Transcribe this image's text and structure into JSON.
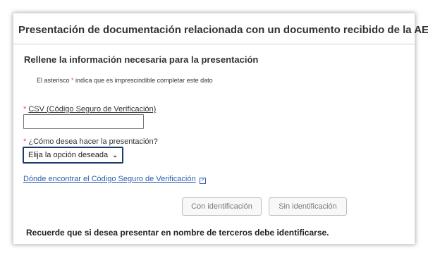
{
  "header": {
    "title": "Presentación de documentación relacionada con un documento recibido de la AEAT"
  },
  "form": {
    "subtitle": "Rellene la información necesaria para la presentación",
    "note_prefix": "El asterisco ",
    "note_star": "*",
    "note_suffix": " indica que es imprescindible completar este dato",
    "csv": {
      "required_mark": "*",
      "label": "CSV (Código Seguro de Verificación)",
      "value": ""
    },
    "how": {
      "required_mark": "*",
      "label": "¿Cómo desea hacer la presentación?",
      "selected": "Elija la opción deseada"
    },
    "help_link": "Dónde encontrar el Código Seguro de Verificación"
  },
  "buttons": {
    "with_id": "Con identificación",
    "without_id": "Sin identificación"
  },
  "footer": "Recuerde que si desea presentar en nombre de terceros debe identificarse.",
  "colors": {
    "required": "#d9534f",
    "link": "#2a5db0",
    "select_border": "#1c3a6e"
  }
}
